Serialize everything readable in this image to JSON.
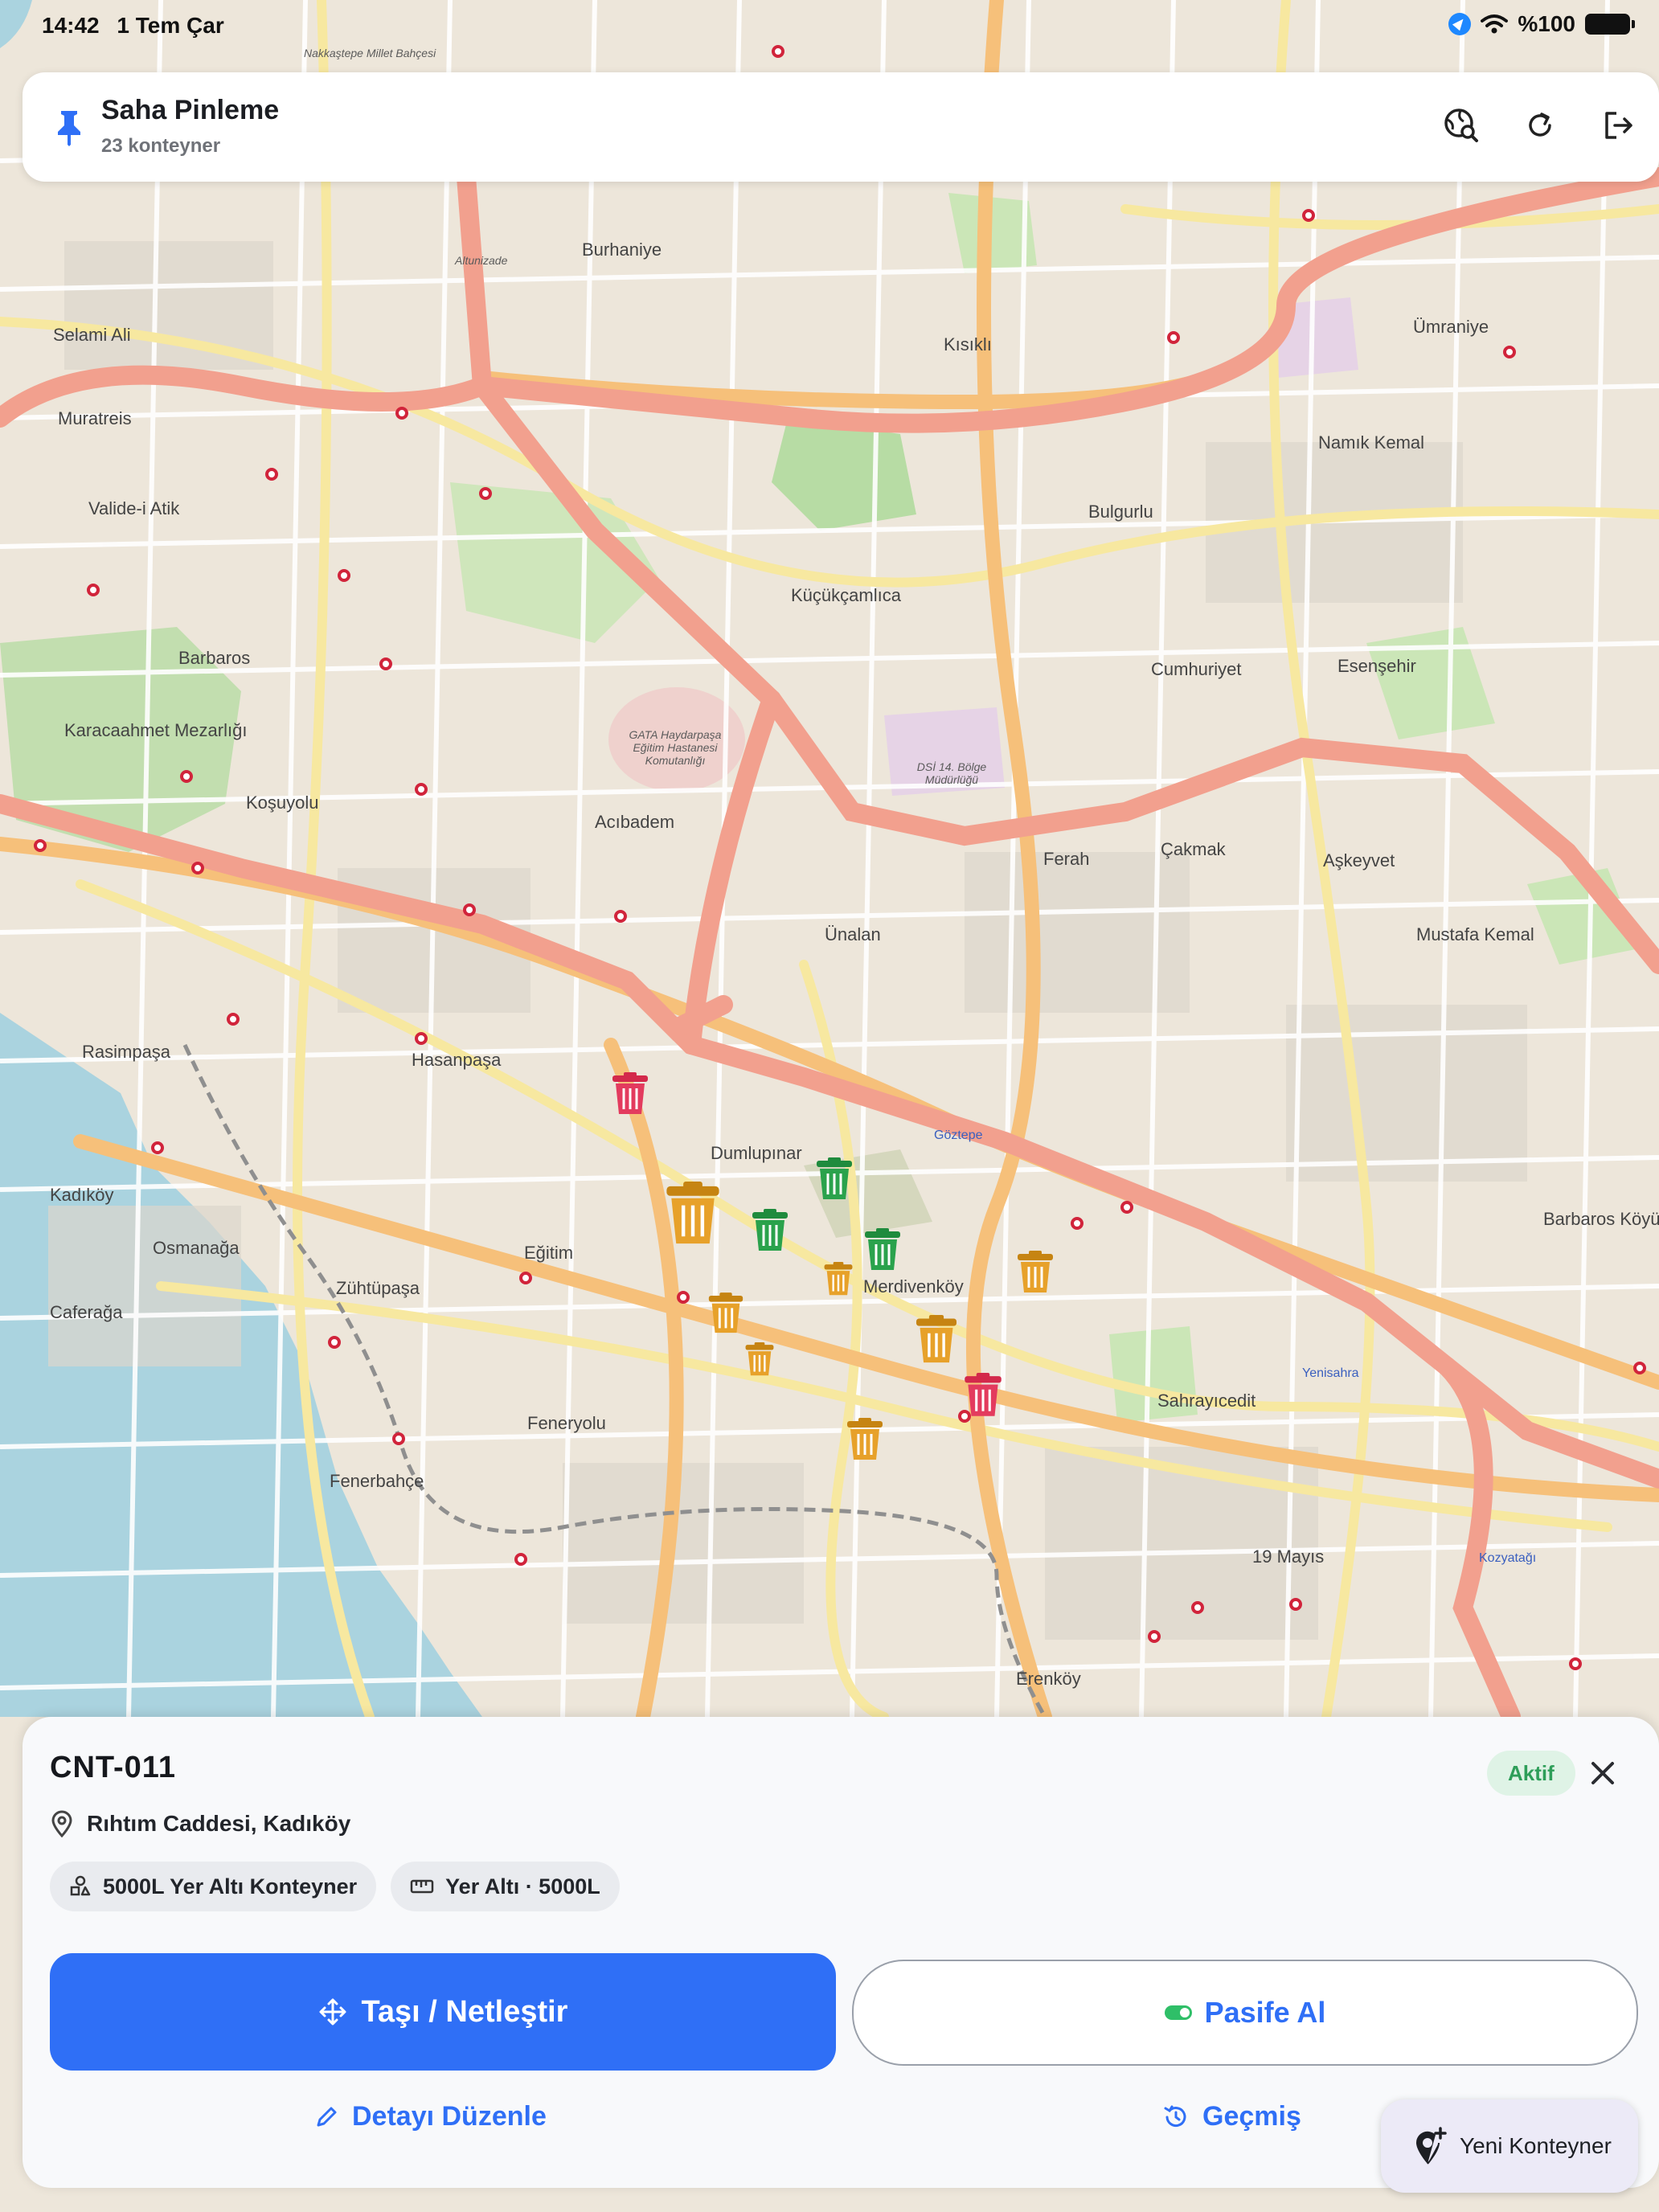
{
  "status_bar": {
    "time": "14:42",
    "date": "1 Tem Çar",
    "battery": "%100"
  },
  "header": {
    "title": "Saha Pinleme",
    "subtitle": "23 konteyner"
  },
  "map": {
    "labels": [
      "Nakkaştepe Millet Bahçesi",
      "Ümraniye",
      "Altunizade",
      "Burhaniye",
      "Kısıklı",
      "Bulgurlu",
      "Küçükçamlıca",
      "Namık Kemal",
      "Selami Ali",
      "Muratreis",
      "Valide-i Atik",
      "Karacaahmet Mezarlığı",
      "Barbaros",
      "GATA Haydarpaşa Eğitim Hastanesi Komutanlığı",
      "DSİ 14. Bölge Müdürlüğü",
      "Esenşehir",
      "Cumhuriyet",
      "Ferah",
      "Çakmak",
      "Aşkeyvet",
      "Mustafa Kemal",
      "Ünalan",
      "Acıbadem",
      "Koşuyolu",
      "Hasanpaşa",
      "Rasimpaşa",
      "Kadıköy",
      "Osmanağa",
      "Zühtüpaşa",
      "Caferağa",
      "Dumlupınar",
      "Merdivenköy",
      "Göztepe",
      "Eğitim",
      "Fenerbahçe",
      "Feneryolu",
      "Sahrayıcedit",
      "Kozyatağı",
      "19 Mayıs",
      "Erenköy",
      "Yenisahra",
      "Barbaros Köyü"
    ]
  },
  "sheet": {
    "id": "CNT-011",
    "status": "Aktif",
    "address": "Rıhtım Caddesi, Kadıköy",
    "chips": [
      "5000L Yer Altı Konteyner",
      "Yer Altı · 5000L"
    ],
    "primary_action": "Taşı / Netleştir",
    "secondary_action": "Pasife Al",
    "edit_link": "Detayı Düzenle",
    "history_link": "Geçmiş"
  },
  "fab": {
    "label": "Yeni Konteyner"
  },
  "colors": {
    "accent": "#2f6ff6",
    "active_green": "#2e9e59",
    "marker_red": "#d3294b",
    "marker_green": "#1f8b3d",
    "marker_orange": "#e7a12a"
  }
}
